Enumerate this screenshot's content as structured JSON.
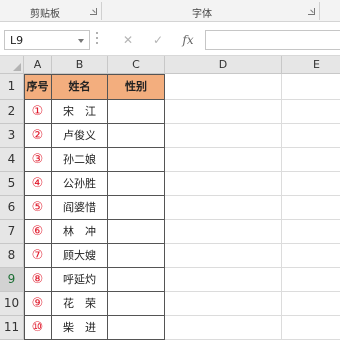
{
  "ribbon": {
    "groups": [
      {
        "label": "剪贴板"
      },
      {
        "label": "字体"
      }
    ]
  },
  "formula_bar": {
    "name_box": "L9",
    "cancel_symbol": "✕",
    "enter_symbol": "✓",
    "fx_symbol": "fx",
    "formula": ""
  },
  "sheet": {
    "columns": [
      "A",
      "B",
      "C",
      "D",
      "E"
    ],
    "rows": [
      "1",
      "2",
      "3",
      "4",
      "5",
      "6",
      "7",
      "8",
      "9",
      "10",
      "11"
    ],
    "headers": [
      "序号",
      "姓名",
      "性别"
    ],
    "data": [
      {
        "idx": "①",
        "name": "宋　江",
        "gender": ""
      },
      {
        "idx": "②",
        "name": "卢俊义",
        "gender": ""
      },
      {
        "idx": "③",
        "name": "孙二娘",
        "gender": ""
      },
      {
        "idx": "④",
        "name": "公孙胜",
        "gender": ""
      },
      {
        "idx": "⑤",
        "name": "阎婆惜",
        "gender": ""
      },
      {
        "idx": "⑥",
        "name": "林　冲",
        "gender": ""
      },
      {
        "idx": "⑦",
        "name": "顾大嫂",
        "gender": ""
      },
      {
        "idx": "⑧",
        "name": "呼延灼",
        "gender": ""
      },
      {
        "idx": "⑨",
        "name": "花　荣",
        "gender": ""
      },
      {
        "idx": "⑩",
        "name": "柴　进",
        "gender": ""
      }
    ],
    "colors": {
      "header_fill": "#f3ae7e",
      "index_text": "#e0182a",
      "selected_row_header": "#d2d2d2"
    }
  }
}
